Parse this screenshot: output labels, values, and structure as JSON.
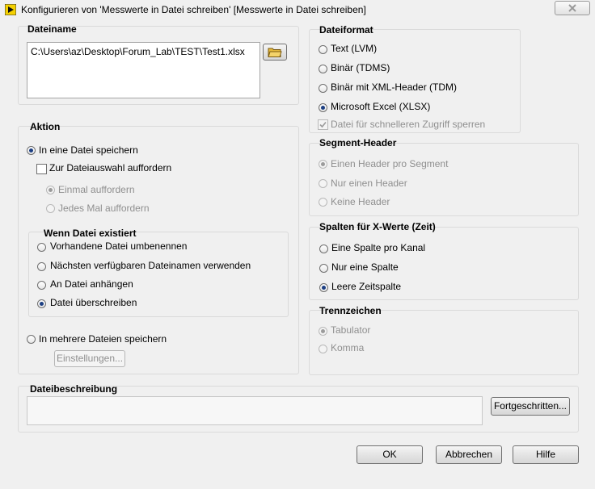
{
  "window": {
    "title": "Konfigurieren von 'Messwerte in Datei schreiben' [Messwerte in Datei schreiben]"
  },
  "filename": {
    "title": "Dateiname",
    "path": "C:\\Users\\az\\Desktop\\Forum_Lab\\TEST\\Test1.xlsx"
  },
  "format": {
    "title": "Dateiformat",
    "options": [
      "Text (LVM)",
      "Binär (TDMS)",
      "Binär mit XML-Header (TDM)",
      "Microsoft Excel (XLSX)"
    ],
    "lock_label": "Datei für schnelleren Zugriff sperren"
  },
  "action": {
    "title": "Aktion",
    "single_file": "In eine Datei speichern",
    "prompt_check": "Zur Dateiauswahl auffordern",
    "prompt_once": "Einmal auffordern",
    "prompt_each": "Jedes Mal auffordern",
    "exists_title": "Wenn Datei existiert",
    "exists_options": [
      "Vorhandene Datei umbenennen",
      "Nächsten verfügbaren Dateinamen verwenden",
      "An Datei anhängen",
      "Datei überschreiben"
    ],
    "multiple_files": "In mehrere Dateien speichern",
    "settings_button": "Einstellungen..."
  },
  "segment": {
    "title": "Segment-Header",
    "options": [
      "Einen Header pro Segment",
      "Nur einen Header",
      "Keine Header"
    ]
  },
  "xcols": {
    "title": "Spalten für X-Werte (Zeit)",
    "options": [
      "Eine Spalte pro Kanal",
      "Nur eine Spalte",
      "Leere Zeitspalte"
    ]
  },
  "delimiter": {
    "title": "Trennzeichen",
    "options": [
      "Tabulator",
      "Komma"
    ]
  },
  "description": {
    "title": "Dateibeschreibung",
    "advanced_button": "Fortgeschritten..."
  },
  "buttons": {
    "ok": "OK",
    "cancel": "Abbrechen",
    "help": "Hilfe"
  }
}
